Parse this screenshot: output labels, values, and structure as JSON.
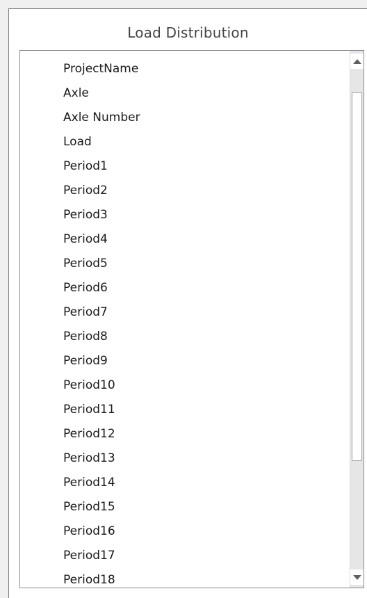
{
  "panel": {
    "title": "Load Distribution"
  },
  "list": {
    "items": [
      {
        "label": "ProjectName"
      },
      {
        "label": "Axle"
      },
      {
        "label": "Axle Number"
      },
      {
        "label": "Load"
      },
      {
        "label": "Period1"
      },
      {
        "label": "Period2"
      },
      {
        "label": "Period3"
      },
      {
        "label": "Period4"
      },
      {
        "label": "Period5"
      },
      {
        "label": "Period6"
      },
      {
        "label": "Period7"
      },
      {
        "label": "Period8"
      },
      {
        "label": "Period9"
      },
      {
        "label": "Period10"
      },
      {
        "label": "Period11"
      },
      {
        "label": "Period12"
      },
      {
        "label": "Period13"
      },
      {
        "label": "Period14"
      },
      {
        "label": "Period15"
      },
      {
        "label": "Period16"
      },
      {
        "label": "Period17"
      },
      {
        "label": "Period18"
      }
    ]
  },
  "scrollbar": {
    "up_icon": "triangle-up-icon",
    "down_icon": "triangle-down-icon",
    "colors": {
      "track": "#e6e6e6",
      "thumb": "#ffffff",
      "arrow": "#606060"
    }
  }
}
